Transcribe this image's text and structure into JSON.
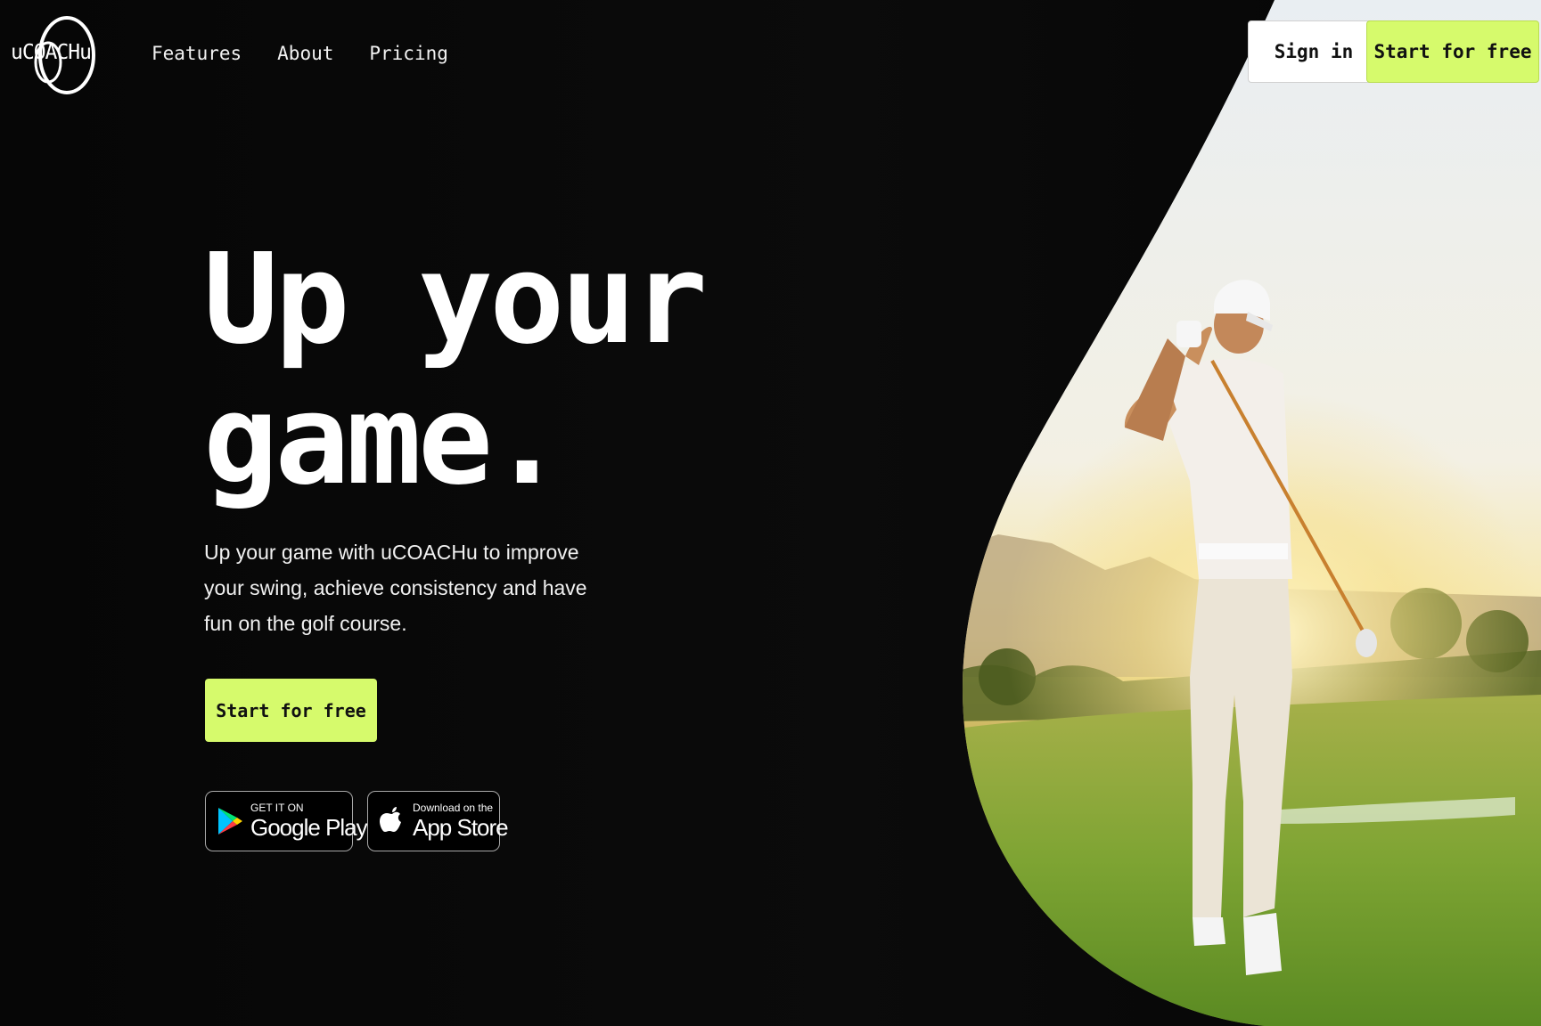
{
  "brand": {
    "logo_text": "uCOACHu",
    "accent_color": "#d6fa6c"
  },
  "nav": {
    "items": [
      {
        "label": "Features"
      },
      {
        "label": "About"
      },
      {
        "label": "Pricing"
      }
    ]
  },
  "header": {
    "sign_in_label": "Sign in",
    "start_label": "Start for free"
  },
  "hero": {
    "title_line1": "Up your",
    "title_line2": "game.",
    "description": "Up your game with uCOACHu to improve your swing, achieve consistency and have fun on the golf course.",
    "cta_label": "Start for free",
    "image_subject": "golfer-swinging-at-sunset"
  },
  "stores": {
    "google": {
      "small": "GET IT ON",
      "big": "Google Play",
      "icon": "google-play-icon"
    },
    "apple": {
      "small": "Download on the",
      "big": "App Store",
      "icon": "apple-icon"
    }
  }
}
